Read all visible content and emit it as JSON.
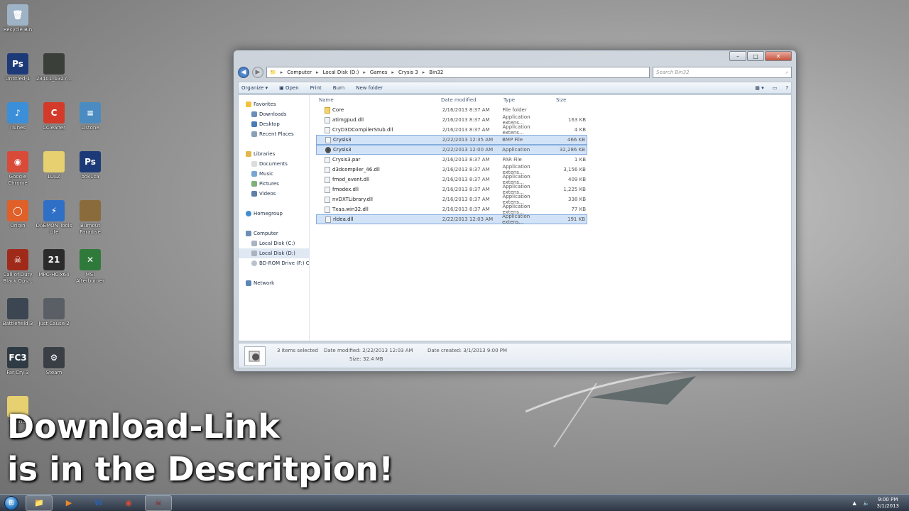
{
  "desktop_icons": [
    {
      "label": "Recycle Bin",
      "glyph": "🗑",
      "color": "#9fb3c6"
    },
    {
      "label": "Untitled-1",
      "glyph": "Ps",
      "color": "#1d3a78"
    },
    {
      "label": "23401_1327...",
      "glyph": "",
      "color": "#3b3f3a"
    },
    {
      "label": "iTunes",
      "glyph": "♪",
      "color": "#3b8fd9"
    },
    {
      "label": "CCleaner",
      "glyph": "C",
      "color": "#d43a2a"
    },
    {
      "label": "Listone",
      "glyph": "≡",
      "color": "#4a8cc2"
    },
    {
      "label": "Google Chrome",
      "glyph": "◉",
      "color": "#d94a38"
    },
    {
      "label": "LULZ",
      "glyph": "",
      "color": "#e7d070"
    },
    {
      "label": "bok1ca",
      "glyph": "Ps",
      "color": "#1d3a78"
    },
    {
      "label": "Origin",
      "glyph": "◯",
      "color": "#e0602a"
    },
    {
      "label": "DAEMON Tools Lite",
      "glyph": "⚡",
      "color": "#2f6fc6"
    },
    {
      "label": "Burnout Paradise",
      "glyph": "",
      "color": "#8a6b3c"
    },
    {
      "label": "Call of Duty Black Ops...",
      "glyph": "☠",
      "color": "#a02a1a"
    },
    {
      "label": "MPC-HC x64",
      "glyph": "21",
      "color": "#2b2b2b"
    },
    {
      "label": "MSI Afterburner",
      "glyph": "✕",
      "color": "#2f7a3a"
    },
    {
      "label": "Battlefield 3",
      "glyph": "",
      "color": "#3b4652"
    },
    {
      "label": "Just Cause 2",
      "glyph": "",
      "color": "#5a5f66"
    },
    {
      "label": "Far Cry 3",
      "glyph": "FC3",
      "color": "#2e3a44"
    },
    {
      "label": "Steam",
      "glyph": "⚙",
      "color": "#3a3f46"
    },
    {
      "label": "Tutorial",
      "glyph": "",
      "color": "#e7d070"
    }
  ],
  "window": {
    "controls": {
      "minimize": "–",
      "maximize": "□",
      "close": "✕"
    },
    "breadcrumb": [
      "Computer",
      "Local Disk (D:)",
      "Games",
      "Crysis 3",
      "Bin32"
    ],
    "search_placeholder": "Search Bin32",
    "toolbar": {
      "organize": "Organize ▾",
      "open": "Open",
      "print": "Print",
      "burn": "Burn",
      "new_folder": "New folder"
    },
    "nav": {
      "favorites": "Favorites",
      "downloads": "Downloads",
      "desktop": "Desktop",
      "recent_places": "Recent Places",
      "libraries": "Libraries",
      "documents": "Documents",
      "music": "Music",
      "pictures": "Pictures",
      "videos": "Videos",
      "homegroup": "Homegroup",
      "computer": "Computer",
      "local_c": "Local Disk (C:)",
      "local_d": "Local Disk (D:)",
      "bd_rom": "BD-ROM Drive (F:) C",
      "network": "Network"
    },
    "columns": {
      "name": "Name",
      "date": "Date modified",
      "type": "Type",
      "size": "Size"
    },
    "files": [
      {
        "name": "Core",
        "date": "2/16/2013 8:37 AM",
        "type": "File folder",
        "size": "",
        "icon": "folder",
        "selected": false
      },
      {
        "name": "atimgpud.dll",
        "date": "2/16/2013 8:37 AM",
        "type": "Application extens...",
        "size": "163 KB",
        "icon": "file",
        "selected": false
      },
      {
        "name": "CryD3DCompilerStub.dll",
        "date": "2/16/2013 8:37 AM",
        "type": "Application extens...",
        "size": "4 KB",
        "icon": "file",
        "selected": false
      },
      {
        "name": "Crysis3",
        "date": "2/22/2013 12:35 AM",
        "type": "BMP File",
        "size": "466 KB",
        "icon": "file",
        "selected": true
      },
      {
        "name": "Crysis3",
        "date": "2/22/2013 12:00 AM",
        "type": "Application",
        "size": "32,286 KB",
        "icon": "app",
        "selected": true
      },
      {
        "name": "Crysis3.par",
        "date": "2/16/2013 8:37 AM",
        "type": "PAR File",
        "size": "1 KB",
        "icon": "file",
        "selected": false
      },
      {
        "name": "d3dcompiler_46.dll",
        "date": "2/16/2013 8:37 AM",
        "type": "Application extens...",
        "size": "3,156 KB",
        "icon": "file",
        "selected": false
      },
      {
        "name": "fmod_event.dll",
        "date": "2/16/2013 8:37 AM",
        "type": "Application extens...",
        "size": "409 KB",
        "icon": "file",
        "selected": false
      },
      {
        "name": "fmodex.dll",
        "date": "2/16/2013 8:37 AM",
        "type": "Application extens...",
        "size": "1,225 KB",
        "icon": "file",
        "selected": false
      },
      {
        "name": "nvDXTLibrary.dll",
        "date": "2/16/2013 8:37 AM",
        "type": "Application extens...",
        "size": "338 KB",
        "icon": "file",
        "selected": false
      },
      {
        "name": "Txaa.win32.dll",
        "date": "2/16/2013 8:37 AM",
        "type": "Application extens...",
        "size": "77 KB",
        "icon": "file",
        "selected": false
      },
      {
        "name": "rldea.dll",
        "date": "2/22/2013 12:03 AM",
        "type": "Application extens...",
        "size": "191 KB",
        "icon": "file",
        "selected": true
      }
    ],
    "details": {
      "selected": "3 items selected",
      "date_modified": "Date modified: 2/22/2013 12:03 AM",
      "date_created": "Date created: 3/1/2013 9:00 PM",
      "size": "Size: 32.4 MB"
    }
  },
  "overlay": {
    "line1": "Download-Link",
    "line2": "is in the Descritpion!"
  },
  "taskbar": {
    "start": "⊞",
    "buttons": [
      {
        "label": "📁",
        "name": "explorer"
      },
      {
        "label": "▶",
        "name": "media-player"
      },
      {
        "label": "W",
        "name": "word"
      },
      {
        "label": "◉",
        "name": "chrome"
      },
      {
        "label": "☠",
        "name": "game"
      }
    ],
    "time": "9:00 PM",
    "date": "3/1/2013"
  }
}
